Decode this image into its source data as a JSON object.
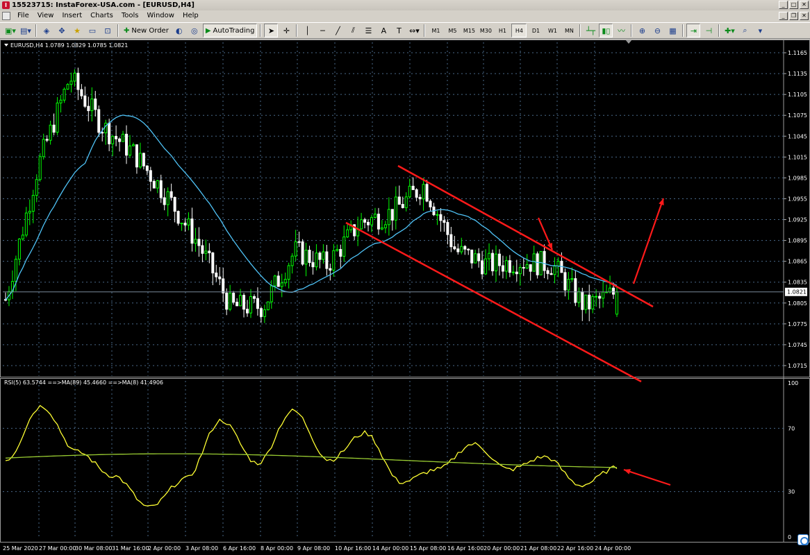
{
  "window": {
    "title": "15523715: InstaForex-USA.com - [EURUSD,H4]"
  },
  "menu": [
    "File",
    "View",
    "Insert",
    "Charts",
    "Tools",
    "Window",
    "Help"
  ],
  "toolbar": {
    "new_order": "New Order",
    "autotrading": "AutoTrading",
    "timeframes": [
      "M1",
      "M5",
      "M15",
      "M30",
      "H1",
      "H4",
      "D1",
      "W1",
      "MN"
    ],
    "active_timeframe": "H4"
  },
  "chart": {
    "header": "EURUSD,H4  1.0789 1.0829 1.0785 1.0821",
    "current_price": "1.0821",
    "price_axis": [
      "1.1165",
      "1.1135",
      "1.1105",
      "1.1075",
      "1.1045",
      "1.1015",
      "1.0985",
      "1.0955",
      "1.0925",
      "1.0895",
      "1.0865",
      "1.0835",
      "1.0805",
      "1.0775",
      "1.0745",
      "1.0715"
    ],
    "time_axis": [
      "25 Mar 2020",
      "27 Mar 00:00",
      "30 Mar 08:00",
      "31 Mar 16:00",
      "2 Apr 00:00",
      "3 Apr 08:00",
      "6 Apr 16:00",
      "8 Apr 00:00",
      "9 Apr 08:00",
      "10 Apr 16:00",
      "14 Apr 00:00",
      "15 Apr 08:00",
      "16 Apr 16:00",
      "20 Apr 00:00",
      "21 Apr 08:00",
      "22 Apr 16:00",
      "24 Apr 00:00"
    ]
  },
  "rsi": {
    "header": "RSI(5) 63.5744  ==>MA(89) 45.4660  ==>MA(8) 41.4906",
    "levels": [
      "100",
      "70",
      "30",
      "0"
    ]
  },
  "colors": {
    "up_candle": "#00ff00",
    "down_candle": "#ffffff",
    "ma_line": "#4fc3f7",
    "rsi_line": "#ffff33",
    "rsi_ma_line": "#9acd32",
    "annotation": "#ff1a1a",
    "grid": "#4a6a8a",
    "background": "#000000"
  },
  "chart_data": {
    "type": "candlestick",
    "symbol": "EURUSD",
    "timeframe": "H4",
    "ylim": [
      1.07,
      1.118
    ],
    "last": {
      "open": 1.0789,
      "high": 1.0829,
      "low": 1.0785,
      "close": 1.0821
    },
    "close_path_approx": [
      {
        "t": "25 Mar 2020",
        "close": 1.081
      },
      {
        "t": "27 Mar 00:00",
        "close": 1.1
      },
      {
        "t": "27 Mar 12:00",
        "close": 1.113
      },
      {
        "t": "30 Mar 08:00",
        "close": 1.106
      },
      {
        "t": "31 Mar 16:00",
        "close": 1.102
      },
      {
        "t": "1 Apr 12:00",
        "close": 1.096
      },
      {
        "t": "2 Apr 00:00",
        "close": 1.089
      },
      {
        "t": "3 Apr 08:00",
        "close": 1.08
      },
      {
        "t": "6 Apr 16:00",
        "close": 1.08
      },
      {
        "t": "7 Apr 12:00",
        "close": 1.088
      },
      {
        "t": "8 Apr 00:00",
        "close": 1.086
      },
      {
        "t": "9 Apr 08:00",
        "close": 1.092
      },
      {
        "t": "10 Apr 16:00",
        "close": 1.0935
      },
      {
        "t": "14 Apr 00:00",
        "close": 1.0975
      },
      {
        "t": "15 Apr 08:00",
        "close": 1.088
      },
      {
        "t": "16 Apr 16:00",
        "close": 1.086
      },
      {
        "t": "20 Apr 00:00",
        "close": 1.0865
      },
      {
        "t": "21 Apr 08:00",
        "close": 1.086
      },
      {
        "t": "22 Apr 16:00",
        "close": 1.08
      },
      {
        "t": "24 Apr 00:00",
        "close": 1.0821
      }
    ],
    "channel": {
      "upper": [
        {
          "t": "14 Apr 00:00",
          "y": 1.0995
        },
        {
          "t": "24 Apr 08:00",
          "y": 1.081
        }
      ],
      "lower": [
        {
          "t": "10 Apr 16:00",
          "y": 1.093
        },
        {
          "t": "24 Apr 08:00",
          "y": 1.0705
        }
      ]
    },
    "rsi_path_approx": [
      50,
      84,
      55,
      40,
      20,
      38,
      75,
      48,
      81,
      50,
      67,
      36,
      44,
      60,
      44,
      52,
      34,
      45
    ]
  }
}
